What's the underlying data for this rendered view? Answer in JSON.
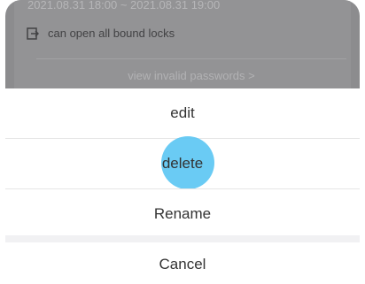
{
  "background": {
    "time_range": "2021.08.31 18:00 ~ 2021.08.31 19:00",
    "scope_label": "can open all bound locks",
    "scope_icon": "door-exit-icon",
    "invalid_link": "view invalid passwords >"
  },
  "action_sheet": {
    "actions": [
      {
        "label": "edit"
      },
      {
        "label": "delete"
      },
      {
        "label": "Rename"
      }
    ],
    "cancel_label": "Cancel"
  },
  "colors": {
    "overlay": "#8c8c8e",
    "touch_highlight": "#5dc7f3",
    "text": "#333333"
  }
}
